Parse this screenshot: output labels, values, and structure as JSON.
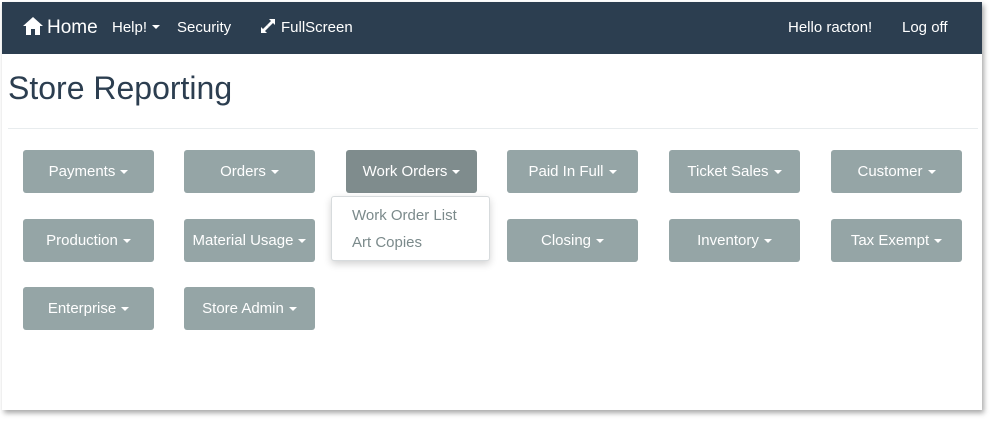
{
  "navbar": {
    "brand": "Home",
    "help": "Help!",
    "security": "Security",
    "fullscreen": "FullScreen",
    "greeting": "Hello racton!",
    "logoff": "Log off"
  },
  "page": {
    "title": "Store Reporting"
  },
  "menu_buttons": [
    "Payments",
    "Orders",
    "Work Orders",
    "Paid In Full",
    "Ticket Sales",
    "Customer",
    "Production",
    "Material Usage",
    "Closing",
    "Inventory",
    "Tax Exempt",
    "Enterprise",
    "Store Admin"
  ],
  "open_dropdown": {
    "parent": "Work Orders",
    "items": [
      "Work Order List",
      "Art Copies"
    ]
  },
  "colors": {
    "navbar": "#2c3e50",
    "button": "#95a5a6",
    "button_active": "#7f8c8d",
    "title": "#2c3e50"
  },
  "icons": {
    "brand": "home-icon",
    "fullscreen": "expand-icon",
    "caret": "caret-down-icon"
  }
}
